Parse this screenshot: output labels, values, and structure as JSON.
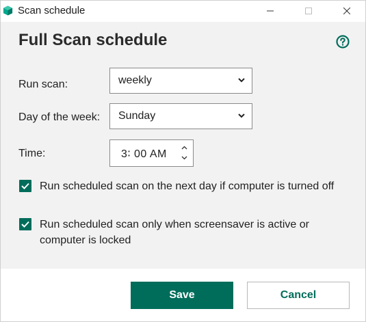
{
  "window": {
    "title": "Scan schedule",
    "controls": [
      "minimize-icon",
      "maximize-icon",
      "close-icon"
    ]
  },
  "page": {
    "heading": "Full Scan schedule",
    "help_icon": "question-circle-icon"
  },
  "fields": {
    "run_scan": {
      "label": "Run scan:",
      "value": "weekly"
    },
    "day_of_week": {
      "label": "Day of the week:",
      "value": "Sunday"
    },
    "time": {
      "label": "Time:",
      "value": "3∶ 00 AM"
    }
  },
  "options": [
    {
      "label": "Run scheduled scan on the next day if computer is turned off",
      "checked": true
    },
    {
      "label": "Run scheduled scan only when screensaver is active or computer is locked",
      "checked": true
    }
  ],
  "footer": {
    "save_label": "Save",
    "cancel_label": "Cancel"
  },
  "colors": {
    "accent": "#006d5b",
    "background": "#f2f2f2",
    "footer_background": "#ffffff"
  }
}
